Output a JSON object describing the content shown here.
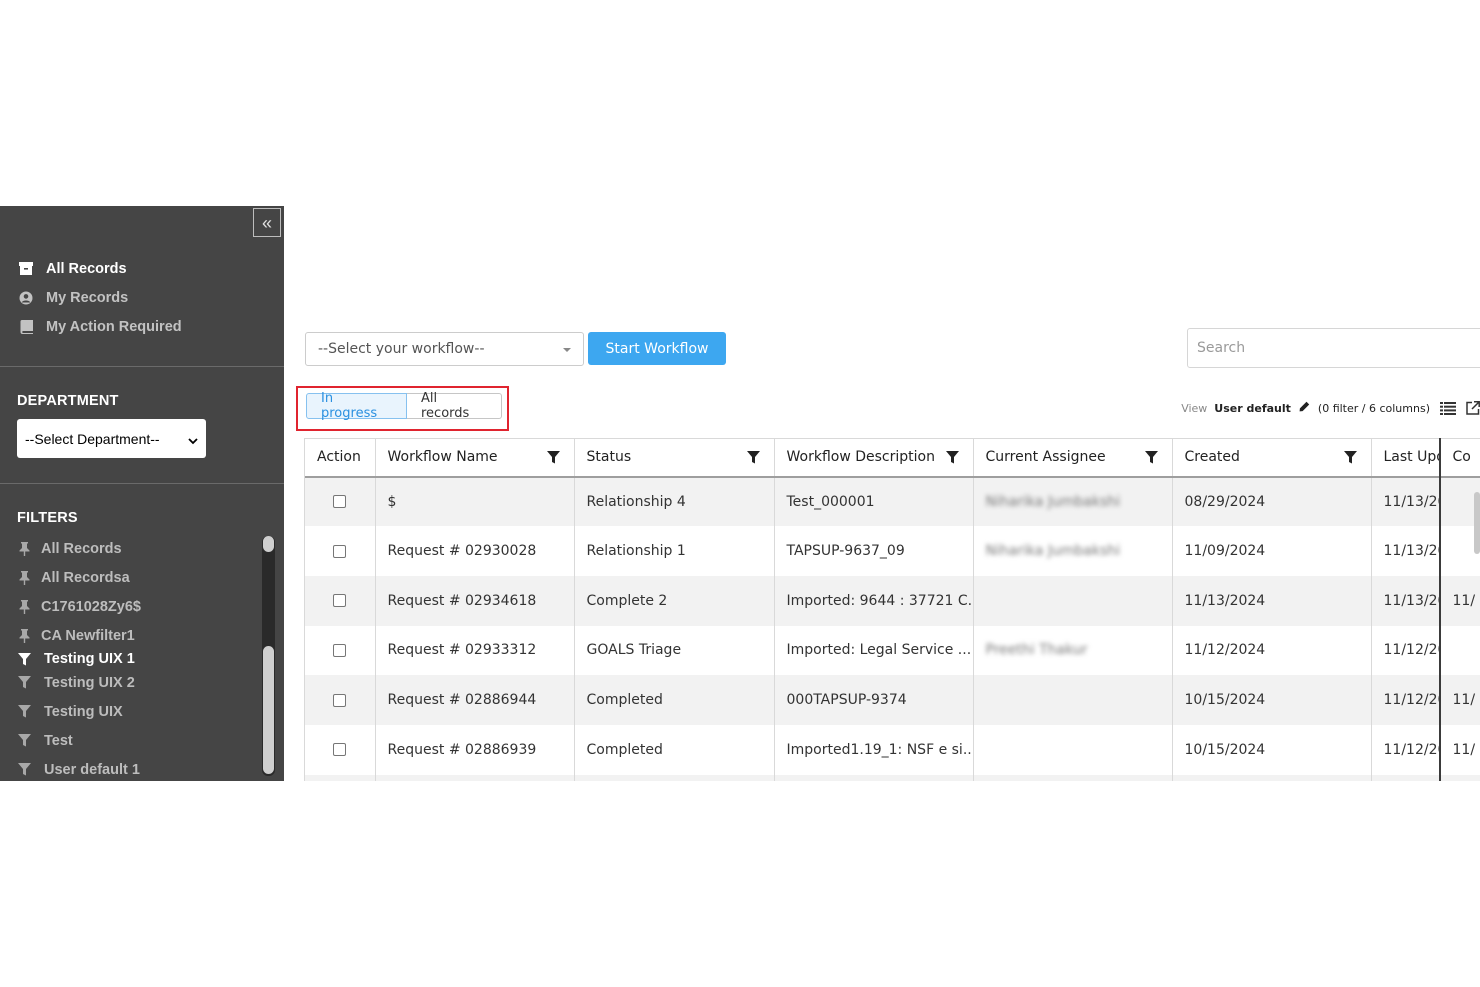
{
  "sidebar": {
    "collapse_glyph": "«",
    "nav": [
      {
        "label": "All Records",
        "icon": "archive-icon",
        "active": true
      },
      {
        "label": "My Records",
        "icon": "user-circle-icon",
        "active": false
      },
      {
        "label": "My Action Required",
        "icon": "book-icon",
        "active": false
      }
    ],
    "department_title": "DEPARTMENT",
    "department_select": "--Select Department--",
    "filters_title": "FILTERS",
    "filters": [
      {
        "label": "All Records",
        "icon": "pin-icon",
        "active": false
      },
      {
        "label": "All Recordsa",
        "icon": "pin-icon",
        "active": false
      },
      {
        "label": "C1761028Zy6$",
        "icon": "pin-icon",
        "active": false
      },
      {
        "label": "CA Newfilter1",
        "icon": "pin-icon",
        "active": false
      },
      {
        "label": "Testing UIX 1",
        "icon": "funnel-icon",
        "active": true
      },
      {
        "label": "Testing UIX 2",
        "icon": "funnel-icon",
        "active": false
      },
      {
        "label": "Testing UIX",
        "icon": "funnel-icon",
        "active": false
      },
      {
        "label": "Test",
        "icon": "funnel-icon",
        "active": false
      },
      {
        "label": "User default 1",
        "icon": "funnel-icon",
        "active": false
      }
    ]
  },
  "toolbar": {
    "workflow_select": "--Select your workflow--",
    "start_label": "Start Workflow",
    "search_placeholder": "Search"
  },
  "toggle": {
    "in_progress": "In progress",
    "all_records": "All records"
  },
  "viewbar": {
    "view_label": "View",
    "view_name": "User default",
    "meta": "(0 filter / 6 columns)"
  },
  "table": {
    "headers": [
      "Action",
      "Workflow Name",
      "Status",
      "Workflow Description",
      "Current Assignee",
      "Created",
      "Last Upd",
      "Co"
    ],
    "rows": [
      {
        "name": "$",
        "status": "Relationship 4",
        "desc": "Test_000001",
        "assignee": "Niharika Jumbakshi",
        "created": "08/29/2024",
        "updated": "11/13/20",
        "co": ""
      },
      {
        "name": "Request # 02930028",
        "status": "Relationship 1",
        "desc": "TAPSUP-9637_09",
        "assignee": "Niharika Jumbakshi",
        "created": "11/09/2024",
        "updated": "11/13/20",
        "co": ""
      },
      {
        "name": "Request # 02934618",
        "status": "Complete 2",
        "desc": "Imported: 9644 : 37721 C...",
        "assignee": "",
        "created": "11/13/2024",
        "updated": "11/13/20",
        "co": "11/"
      },
      {
        "name": "Request # 02933312",
        "status": "GOALS Triage",
        "desc": "Imported: Legal Service ...",
        "assignee": "Preethi Thakur",
        "created": "11/12/2024",
        "updated": "11/12/20",
        "co": ""
      },
      {
        "name": "Request # 02886944",
        "status": "Completed",
        "desc": "000TAPSUP-9374",
        "assignee": "",
        "created": "10/15/2024",
        "updated": "11/12/20",
        "co": "11/"
      },
      {
        "name": "Request # 02886939",
        "status": "Completed",
        "desc": "Imported1.19_1: NSF e si...",
        "assignee": "",
        "created": "10/15/2024",
        "updated": "11/12/20",
        "co": "11/"
      },
      {
        "name": "",
        "status": "",
        "desc": "",
        "assignee": "",
        "created": "",
        "updated": "",
        "co": ""
      }
    ]
  },
  "colors": {
    "sidebar_bg": "#454545",
    "primary_button": "#3da7f0",
    "highlight_border": "#e0242f",
    "toggle_active_text": "#2a90e0"
  }
}
